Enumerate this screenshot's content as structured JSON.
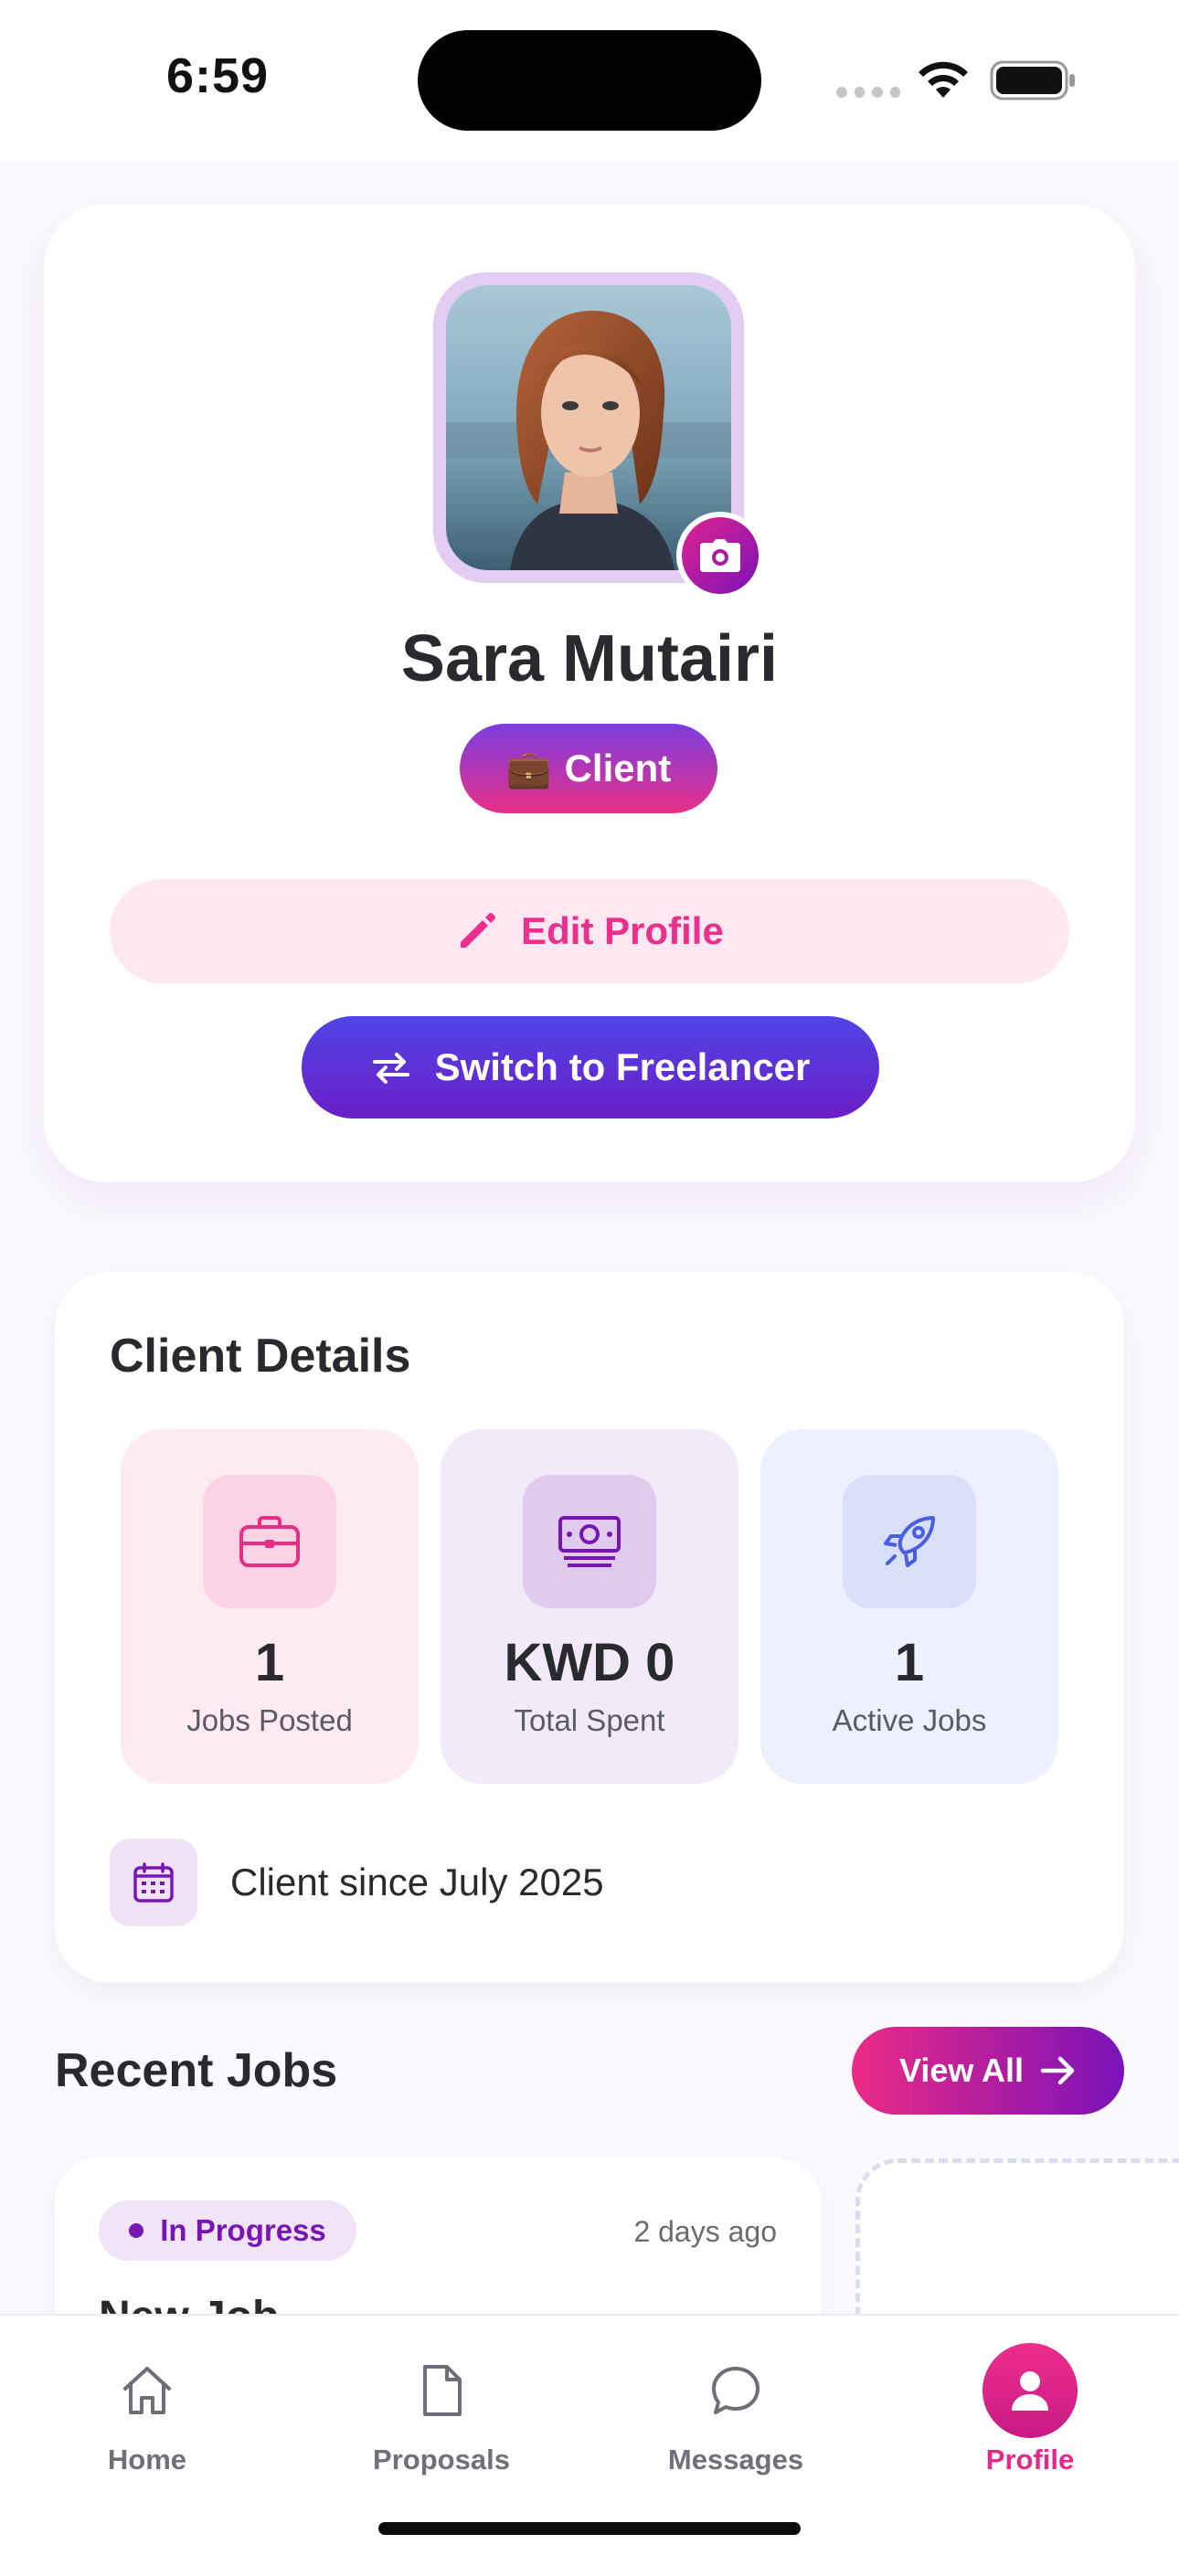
{
  "status_bar": {
    "time": "6:59"
  },
  "profile": {
    "name": "Sara Mutairi",
    "role_icon": "💼",
    "role": "Client",
    "edit_label": "Edit Profile",
    "switch_label": "Switch to Freelancer"
  },
  "client_details": {
    "title": "Client Details",
    "stats": [
      {
        "value": "1",
        "label": "Jobs Posted",
        "icon": "briefcase-icon"
      },
      {
        "value": "KWD 0",
        "label": "Total Spent",
        "icon": "money-icon"
      },
      {
        "value": "1",
        "label": "Active Jobs",
        "icon": "rocket-icon"
      }
    ],
    "since": "Client since July 2025"
  },
  "recent_jobs": {
    "title": "Recent Jobs",
    "view_all": "View All",
    "jobs": [
      {
        "status": "In Progress",
        "time": "2 days ago",
        "title": "New Job"
      }
    ]
  },
  "tab_bar": {
    "tabs": [
      {
        "label": "Home",
        "icon": "home-icon"
      },
      {
        "label": "Proposals",
        "icon": "document-icon"
      },
      {
        "label": "Messages",
        "icon": "chat-icon"
      },
      {
        "label": "Profile",
        "icon": "user-icon",
        "active": true
      }
    ]
  },
  "colors": {
    "accent_pink": "#e8278a",
    "accent_purple": "#7a12b8",
    "accent_indigo": "#4e45e6"
  }
}
